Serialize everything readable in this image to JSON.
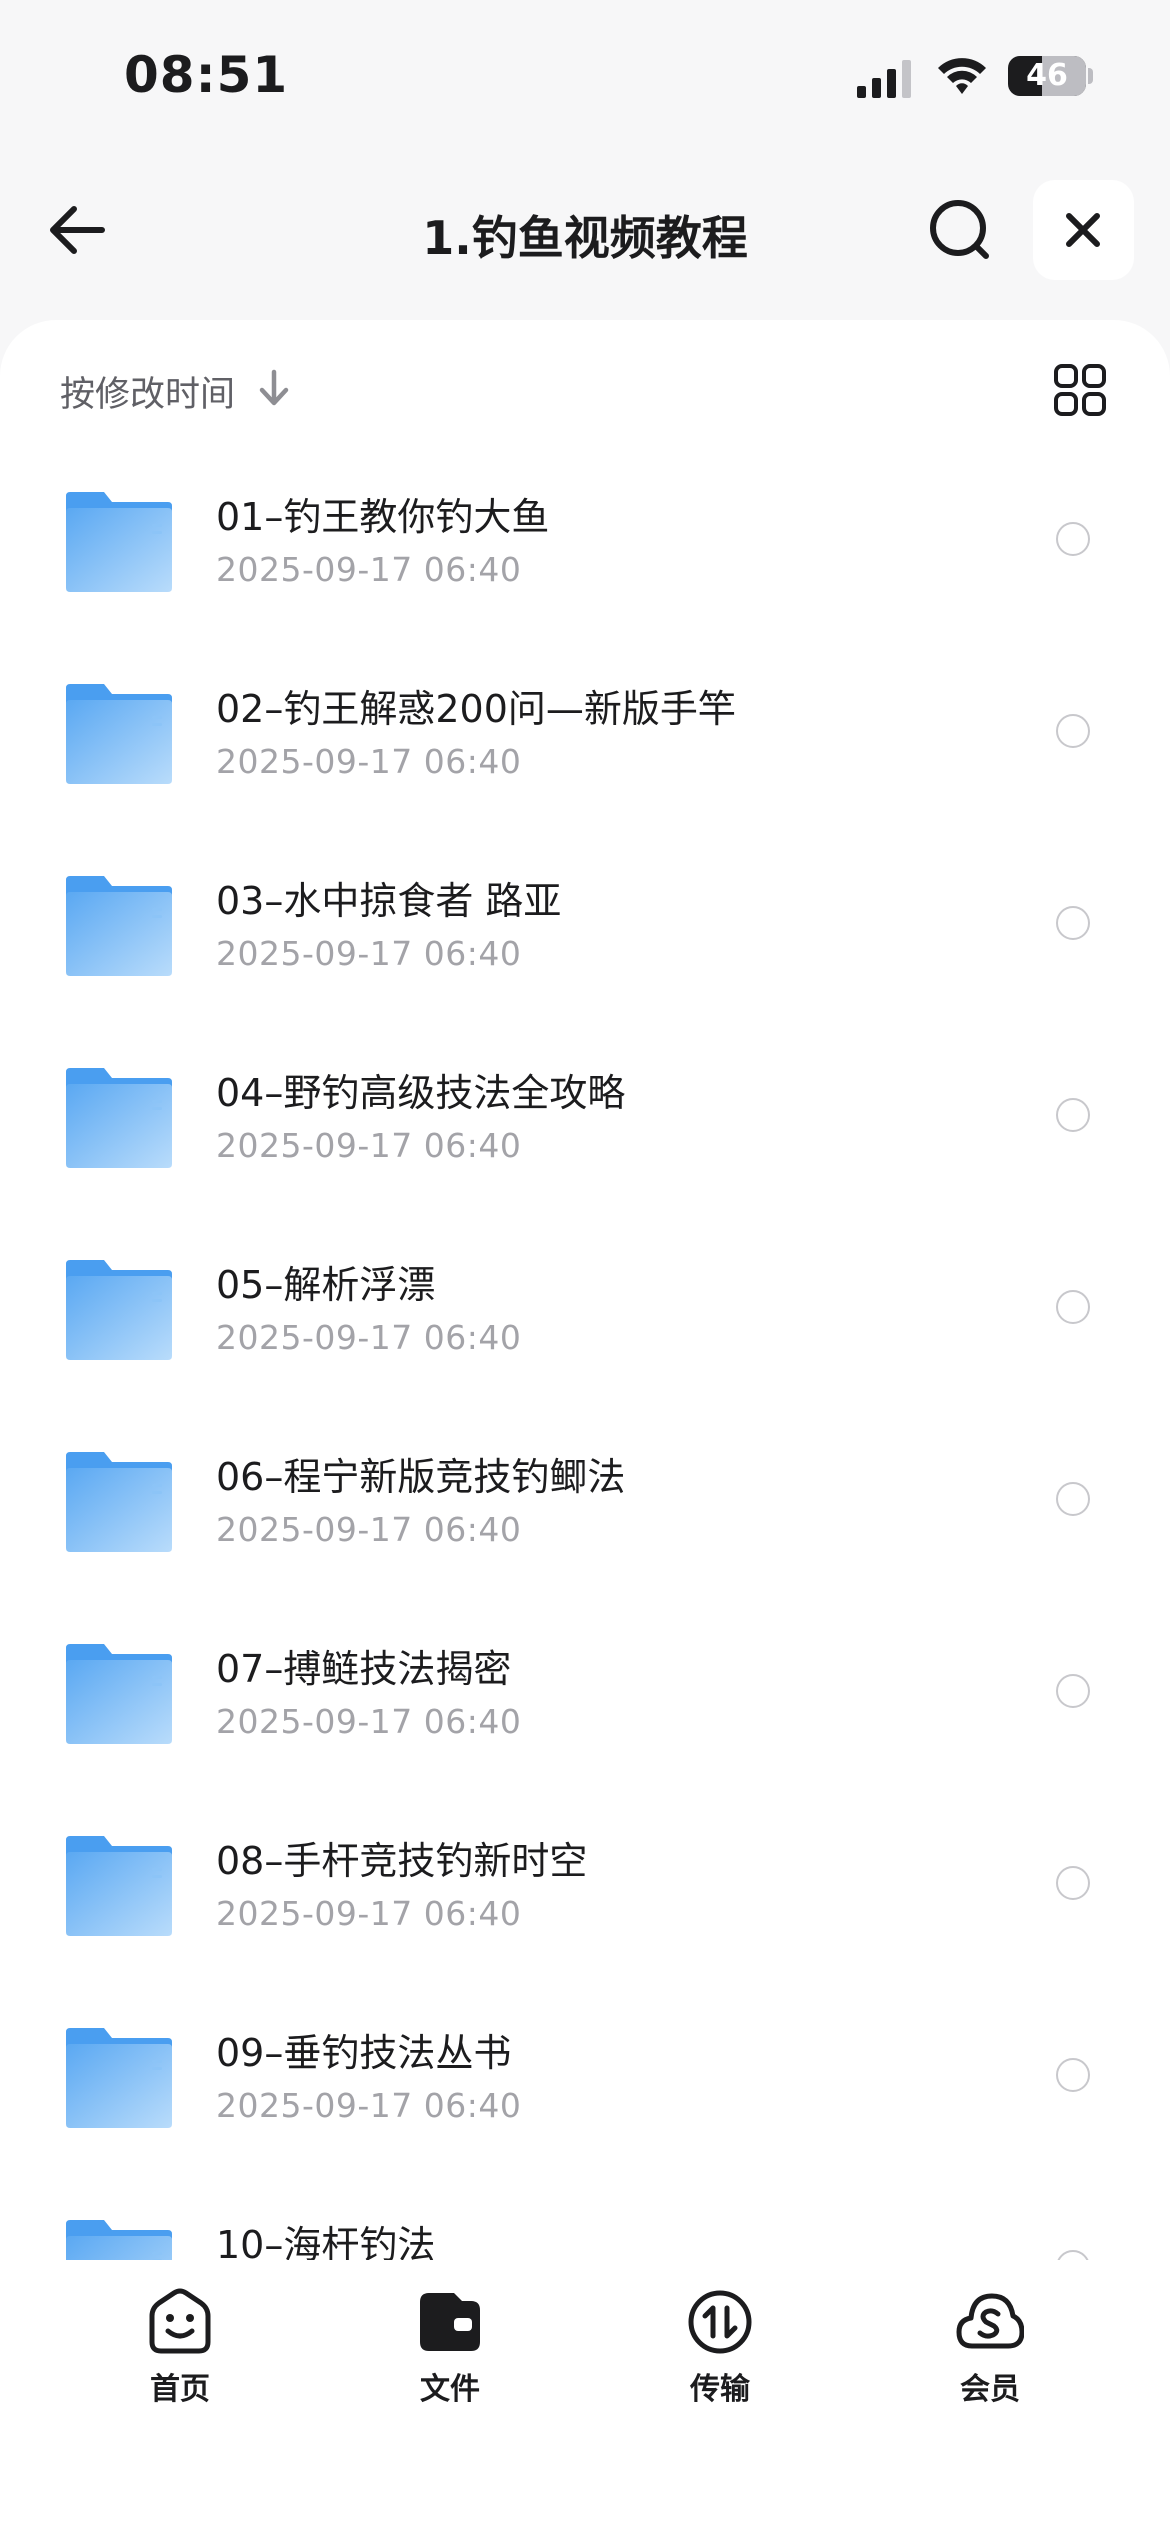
{
  "status_bar": {
    "time": "08:51",
    "battery": "46"
  },
  "nav": {
    "title": "1.钓鱼视频教程"
  },
  "sort": {
    "label": "按修改时间"
  },
  "files": [
    {
      "name": "01–钓王教你钓大鱼",
      "date": "2025-09-17 06:40"
    },
    {
      "name": "02–钓王解惑200问—新版手竿",
      "date": "2025-09-17 06:40"
    },
    {
      "name": "03–水中掠食者 路亚",
      "date": "2025-09-17 06:40"
    },
    {
      "name": "04–野钓高级技法全攻略",
      "date": "2025-09-17 06:40"
    },
    {
      "name": "05–解析浮漂",
      "date": "2025-09-17 06:40"
    },
    {
      "name": "06–程宁新版竞技钓鲫法",
      "date": "2025-09-17 06:40"
    },
    {
      "name": "07–搏鲢技法揭密",
      "date": "2025-09-17 06:40"
    },
    {
      "name": "08–手杆竞技钓新时空",
      "date": "2025-09-17 06:40"
    },
    {
      "name": "09–垂钓技法丛书",
      "date": "2025-09-17 06:40"
    },
    {
      "name": "10–海杆钓法",
      "date": ""
    }
  ],
  "tabs": [
    {
      "label": "首页",
      "icon": "home-smile-icon"
    },
    {
      "label": "文件",
      "icon": "files-wallet-icon"
    },
    {
      "label": "传输",
      "icon": "transfer-icon"
    },
    {
      "label": "会员",
      "icon": "vip-cloud-icon"
    }
  ],
  "colors": {
    "folder": "#6fb3f5",
    "accent": "#1c1c1e",
    "secondary_text": "#a3a3a8"
  }
}
